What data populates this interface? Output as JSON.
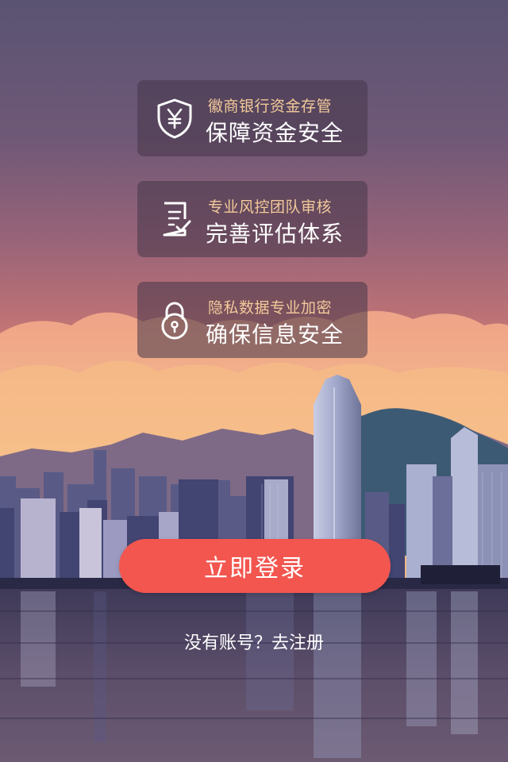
{
  "features": [
    {
      "icon": "shield-yen-icon",
      "subtitle": "徽商银行资金存管",
      "title": "保障资金安全"
    },
    {
      "icon": "document-check-icon",
      "subtitle": "专业风控团队审核",
      "title": "完善评估体系"
    },
    {
      "icon": "padlock-icon",
      "subtitle": "隐私数据专业加密",
      "title": "确保信息安全"
    }
  ],
  "login_button": "立即登录",
  "register_link": "没有账号？去注册",
  "colors": {
    "accent": "#f2564f",
    "subtitle": "#f3c99a",
    "card_bg": "rgba(70,55,72,0.55)"
  }
}
